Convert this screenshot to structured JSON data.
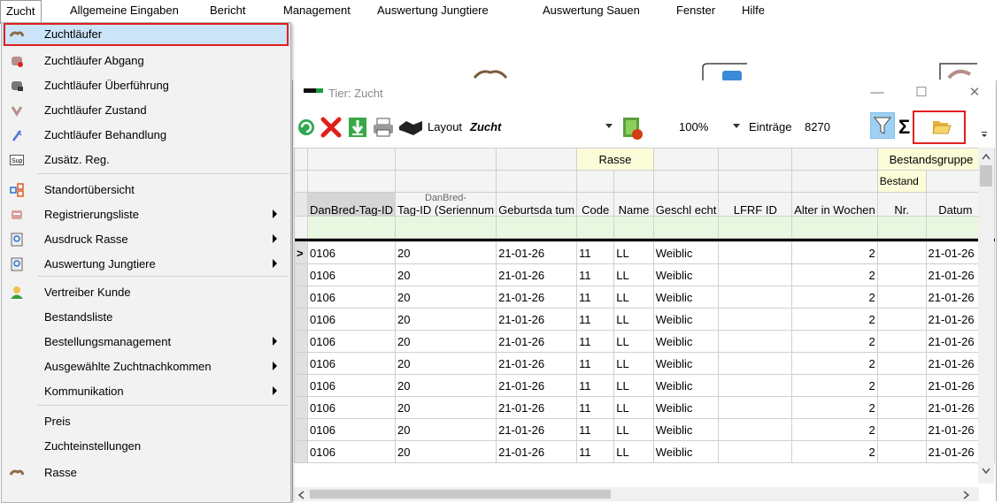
{
  "menubar": {
    "items": [
      "Zucht",
      "Allgemeine Eingaben",
      "Bericht",
      "Management",
      "Auswertung Jungtiere",
      "Auswertung Sauen",
      "Fenster",
      "Hilfe"
    ]
  },
  "dropdown": {
    "items": [
      {
        "label": "Zuchtläufer",
        "icon": "pig-icon",
        "selected": true
      },
      {
        "label": "Zuchtläufer Abgang",
        "icon": "pig-remove-icon"
      },
      {
        "label": "Zuchtläufer Überführung",
        "icon": "pig-transfer-icon"
      },
      {
        "label": "Zuchtläufer Zustand",
        "icon": "pig-status-icon"
      },
      {
        "label": "Zuchtläufer Behandlung",
        "icon": "syringe-icon"
      },
      {
        "label": "Zusätz. Reg.",
        "icon": "sup-icon",
        "icon_text": "Sup"
      },
      {
        "label": "Standortübersicht",
        "icon": "location-grid-icon"
      },
      {
        "label": "Registrierungsliste",
        "icon": "register-list-icon",
        "submenu": true
      },
      {
        "label": "Ausdruck Rasse",
        "icon": "print-preview-icon",
        "submenu": true
      },
      {
        "label": "Auswertung Jungtiere",
        "icon": "print-preview-icon",
        "submenu": true
      },
      {
        "label": "Vertreiber Kunde",
        "icon": "customer-icon"
      },
      {
        "label": "Bestandsliste"
      },
      {
        "label": "Bestellungsmanagement",
        "submenu": true
      },
      {
        "label": "Ausgewählte Zuchtnachkommen",
        "submenu": true
      },
      {
        "label": "Kommunikation",
        "submenu": true
      },
      {
        "label": "Preis"
      },
      {
        "label": "Zuchteinstellungen"
      },
      {
        "label": "Rasse",
        "icon": "pig-icon"
      }
    ]
  },
  "window": {
    "title": "Tier: Zucht",
    "minimize": "—",
    "maximize": "☐",
    "close": "✕",
    "toolbar": {
      "layout_label": "Layout",
      "layout_value": "Zucht",
      "zoom_value": "100%",
      "entries_label": "Einträge",
      "entries_value": "8270"
    }
  },
  "grid": {
    "group_headers": {
      "rasse": "Rasse",
      "bestandsgruppe": "Bestandsgruppe",
      "bestand": "Bestand"
    },
    "columns": {
      "danbred": "DanBred-Tag-ID",
      "serial_top": "DanBred-",
      "serial": "Tag-ID (Seriennum",
      "geburt": "Geburtsda tum",
      "code": "Code",
      "name": "Name",
      "geschlecht": "Geschl echt",
      "lfrf": "LFRF ID",
      "alter": "Alter in Wochen",
      "nr": "Nr.",
      "datum": "Datum"
    },
    "row_indicator": ">",
    "rows": [
      {
        "tag": "0106",
        "serial": "20",
        "date": "21-01-26",
        "code": "11",
        "name": "LL",
        "sex": "Weiblic",
        "age": "2",
        "datum": "21-01-26"
      },
      {
        "tag": "0106",
        "serial": "20",
        "date": "21-01-26",
        "code": "11",
        "name": "LL",
        "sex": "Weiblic",
        "age": "2",
        "datum": "21-01-26"
      },
      {
        "tag": "0106",
        "serial": "20",
        "date": "21-01-26",
        "code": "11",
        "name": "LL",
        "sex": "Weiblic",
        "age": "2",
        "datum": "21-01-26"
      },
      {
        "tag": "0106",
        "serial": "20",
        "date": "21-01-26",
        "code": "11",
        "name": "LL",
        "sex": "Weiblic",
        "age": "2",
        "datum": "21-01-26"
      },
      {
        "tag": "0106",
        "serial": "20",
        "date": "21-01-26",
        "code": "11",
        "name": "LL",
        "sex": "Weiblic",
        "age": "2",
        "datum": "21-01-26"
      },
      {
        "tag": "0106",
        "serial": "20",
        "date": "21-01-26",
        "code": "11",
        "name": "LL",
        "sex": "Weiblic",
        "age": "2",
        "datum": "21-01-26"
      },
      {
        "tag": "0106",
        "serial": "20",
        "date": "21-01-26",
        "code": "11",
        "name": "LL",
        "sex": "Weiblic",
        "age": "2",
        "datum": "21-01-26"
      },
      {
        "tag": "0106",
        "serial": "20",
        "date": "21-01-26",
        "code": "11",
        "name": "LL",
        "sex": "Weiblic",
        "age": "2",
        "datum": "21-01-26"
      },
      {
        "tag": "0106",
        "serial": "20",
        "date": "21-01-26",
        "code": "11",
        "name": "LL",
        "sex": "Weiblic",
        "age": "2",
        "datum": "21-01-26"
      },
      {
        "tag": "0106",
        "serial": "20",
        "date": "21-01-26",
        "code": "11",
        "name": "LL",
        "sex": "Weiblic",
        "age": "2",
        "datum": "21-01-26"
      }
    ]
  },
  "colors": {
    "highlight_frame": "#e02020",
    "selected_bg": "#cce4f7",
    "group_header_bg": "#fdfcd8",
    "filter_row_bg": "#e8f8e0"
  }
}
